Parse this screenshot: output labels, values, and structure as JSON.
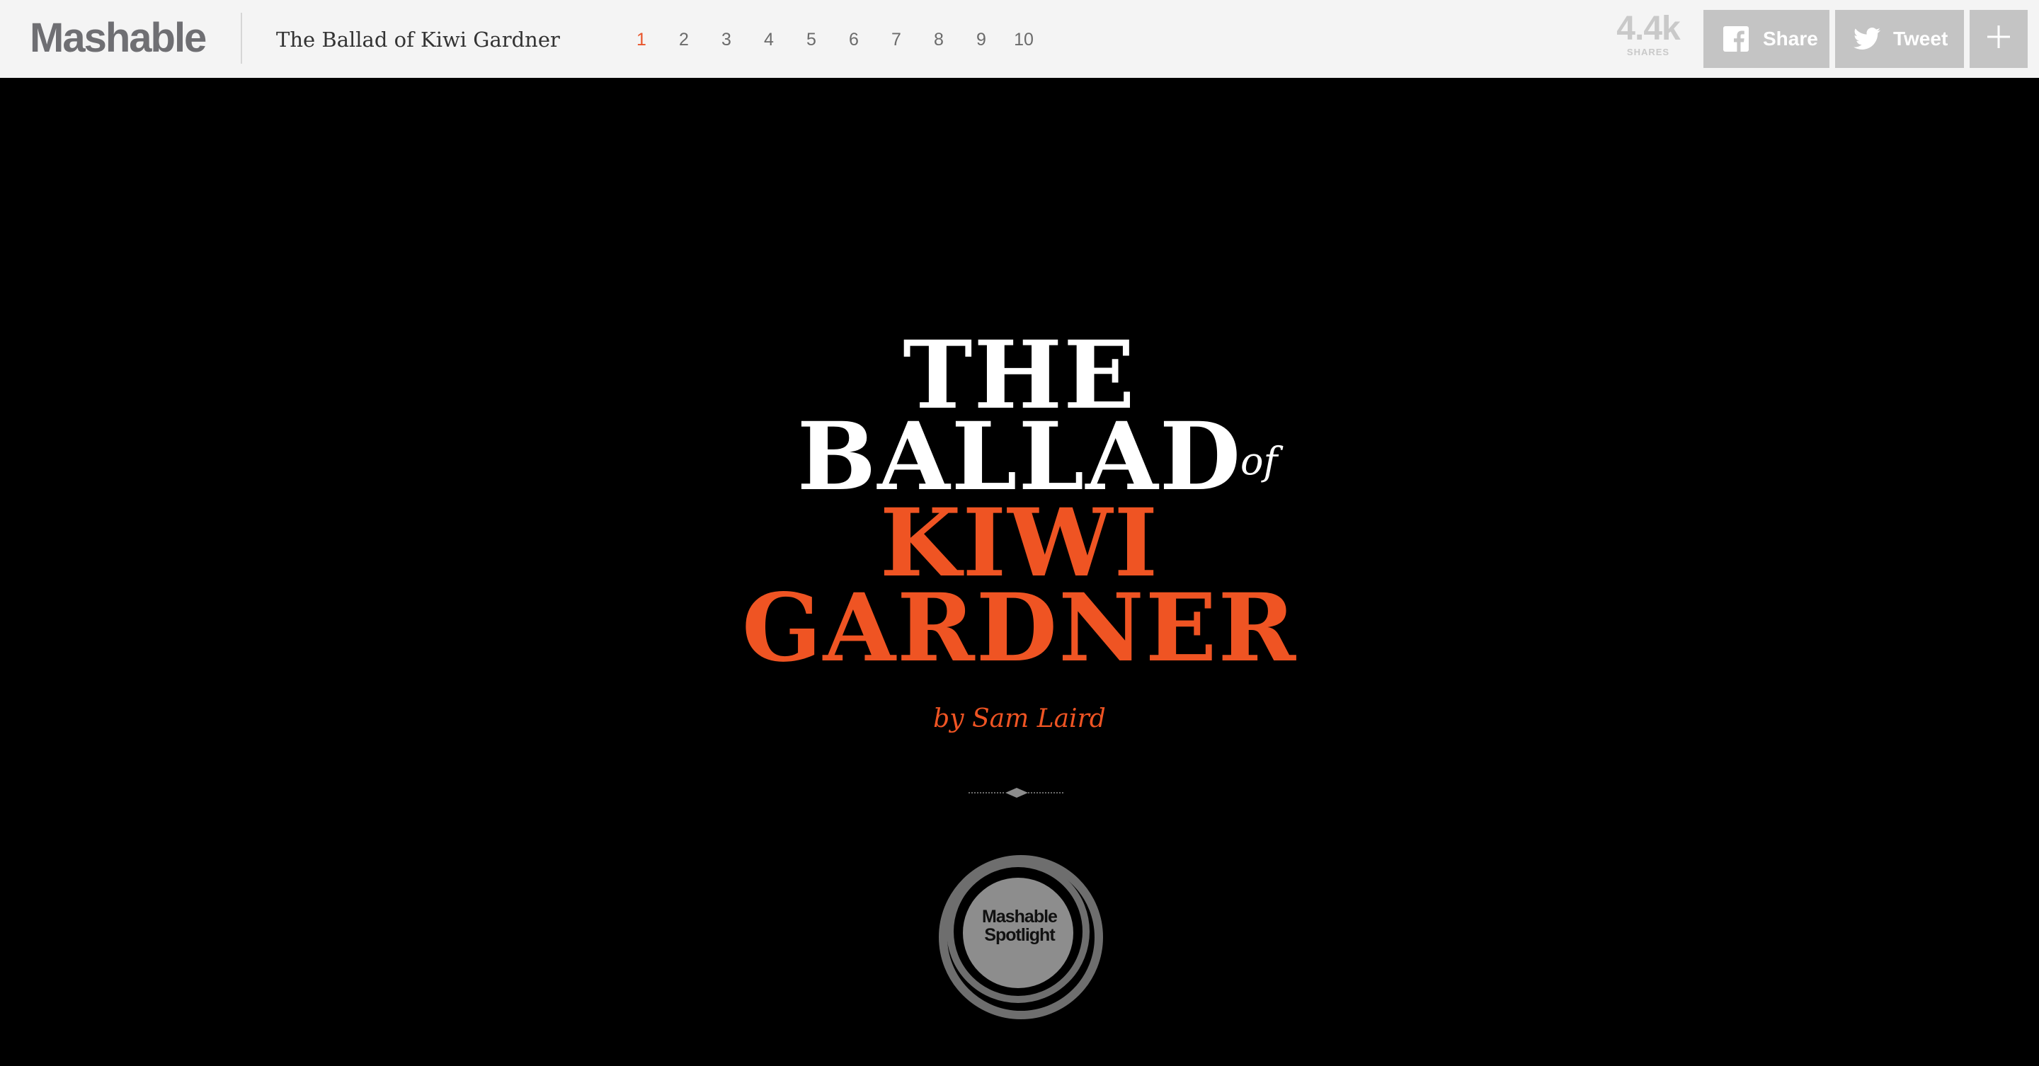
{
  "header": {
    "logo": "Mashable",
    "story_title": "The Ballad of Kiwi Gardner",
    "pages": [
      "1",
      "2",
      "3",
      "4",
      "5",
      "6",
      "7",
      "8",
      "9",
      "10"
    ],
    "active_page": "1",
    "shares_count": "4.4k",
    "shares_label": "SHARES",
    "share_label": "Share",
    "tweet_label": "Tweet",
    "more_icon": "plus-icon"
  },
  "hero": {
    "line1": "THE",
    "line2": "BALLAD",
    "of": "of",
    "line3": "KIWI",
    "line4": "GARDNER",
    "byline": "by Sam Laird",
    "badge_line1": "Mashable",
    "badge_line2": "Spotlight"
  },
  "colors": {
    "accent": "#ef5423",
    "header_bg": "#f4f4f4",
    "button_bg": "#c4c4c4",
    "page_bg": "#000000"
  }
}
